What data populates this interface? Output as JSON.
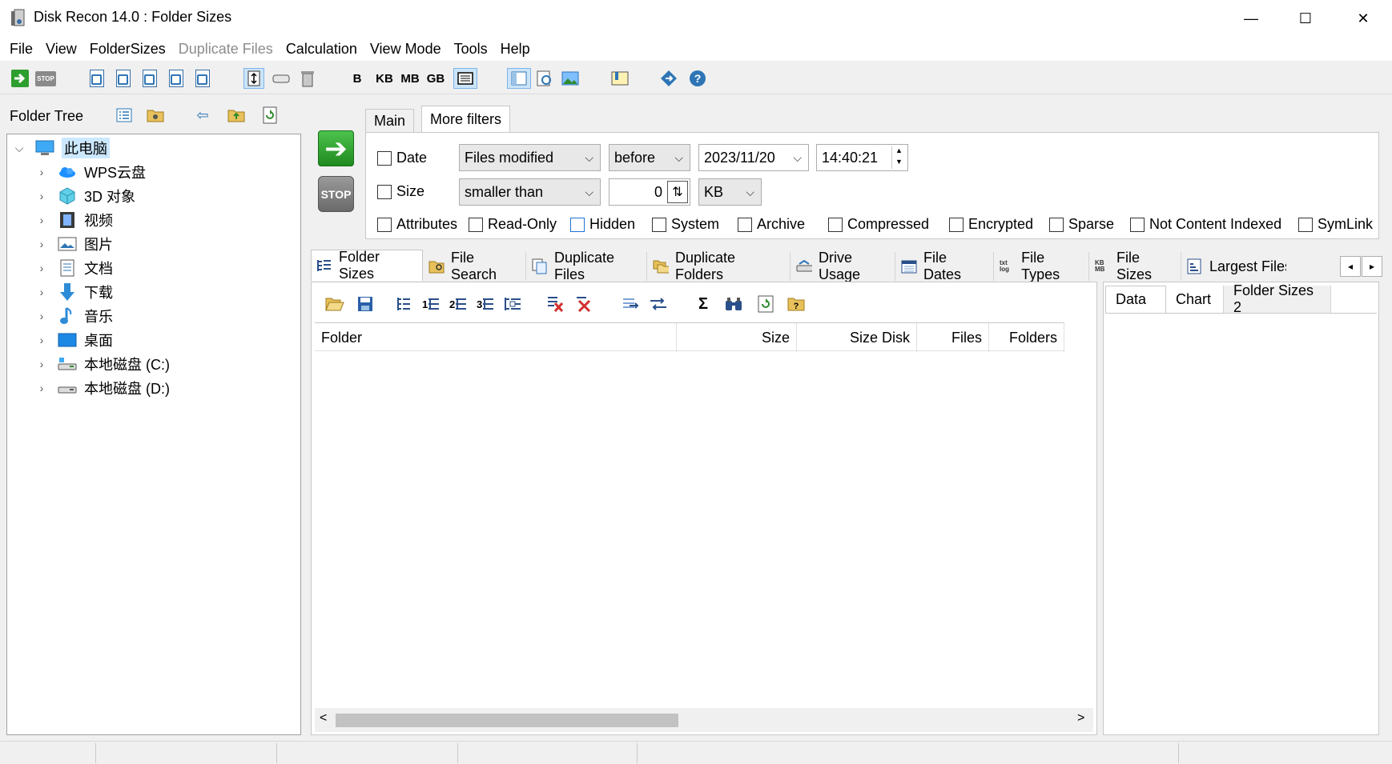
{
  "window": {
    "title": "Disk Recon 14.0 : Folder Sizes",
    "minimize_glyph": "—",
    "maximize_glyph": "☐",
    "close_glyph": "✕"
  },
  "menu": [
    "File",
    "View",
    "FolderSizes",
    "Duplicate Files",
    "Calculation",
    "View Mode",
    "Tools",
    "Help"
  ],
  "toolbar": {
    "start_icon": "start-arrow-icon",
    "stop_label": "STOP",
    "size_units": [
      "B",
      "KB",
      "MB",
      "GB"
    ]
  },
  "folder_tree": {
    "label": "Folder Tree",
    "back_glyph": "⇦",
    "items": [
      {
        "label": "此电脑",
        "icon": "computer-icon",
        "expanded": true
      },
      {
        "label": "WPS云盘",
        "icon": "cloud-icon"
      },
      {
        "label": "3D 对象",
        "icon": "3d-objects-icon"
      },
      {
        "label": "视频",
        "icon": "video-icon"
      },
      {
        "label": "图片",
        "icon": "pictures-icon"
      },
      {
        "label": "文档",
        "icon": "documents-icon"
      },
      {
        "label": "下载",
        "icon": "download-icon"
      },
      {
        "label": "音乐",
        "icon": "music-icon"
      },
      {
        "label": "桌面",
        "icon": "desktop-icon"
      },
      {
        "label": "本地磁盘 (C:)",
        "icon": "drive-c-icon"
      },
      {
        "label": "本地磁盘 (D:)",
        "icon": "drive-d-icon"
      }
    ]
  },
  "actions": {
    "go_glyph": "➔",
    "stop_label": "STOP"
  },
  "filters": {
    "tabs": [
      "Main",
      "More filters"
    ],
    "active_tab": "More filters",
    "date": {
      "label": "Date",
      "checked": false,
      "mode": "Files modified",
      "relation": "before",
      "date": "2023/11/20",
      "time": "14:40:21"
    },
    "size": {
      "label": "Size",
      "checked": false,
      "relation": "smaller than",
      "value": "0",
      "unit": "KB"
    },
    "attributes": [
      "Attributes",
      "Read-Only",
      "Hidden",
      "System",
      "Archive",
      "Compressed",
      "Encrypted",
      "Sparse",
      "Not Content Indexed",
      "SymLink"
    ],
    "arrow_down": "⌵",
    "spin_up": "▲",
    "spin_down": "▼",
    "spin_updown": "⇅"
  },
  "main_tabs": {
    "items": [
      {
        "label": "Folder Sizes",
        "icon": "folder-sizes-icon",
        "active": true
      },
      {
        "label": "File Search",
        "icon": "file-search-icon"
      },
      {
        "label": "Duplicate Files",
        "icon": "duplicate-files-icon"
      },
      {
        "label": "Duplicate Folders",
        "icon": "duplicate-folders-icon"
      },
      {
        "label": "Drive Usage",
        "icon": "drive-usage-icon"
      },
      {
        "label": "File Dates",
        "icon": "file-dates-icon"
      },
      {
        "label": "File Types",
        "icon": "file-types-icon"
      },
      {
        "label": "File Sizes",
        "icon": "file-sizes-icon"
      },
      {
        "label": "Largest Files",
        "icon": "largest-files-icon"
      }
    ],
    "file_types_glyph": "txt log",
    "file_sizes_glyph": "KB MB",
    "scroll_left": "◂",
    "scroll_right": "▸"
  },
  "grid": {
    "columns": [
      "Folder",
      "Size",
      "Size Disk",
      "Files",
      "Folders"
    ],
    "rows": [],
    "sigma": "Σ",
    "scroll_left": "<",
    "scroll_right": ">"
  },
  "right_panel": {
    "tabs": [
      "Data",
      "Chart",
      "Folder Sizes 2"
    ],
    "active_tab": "Data"
  },
  "colors": {
    "accent_blue": "#1e73d6",
    "go_green": "#1f8a1f",
    "selection": "#cce8ff"
  }
}
